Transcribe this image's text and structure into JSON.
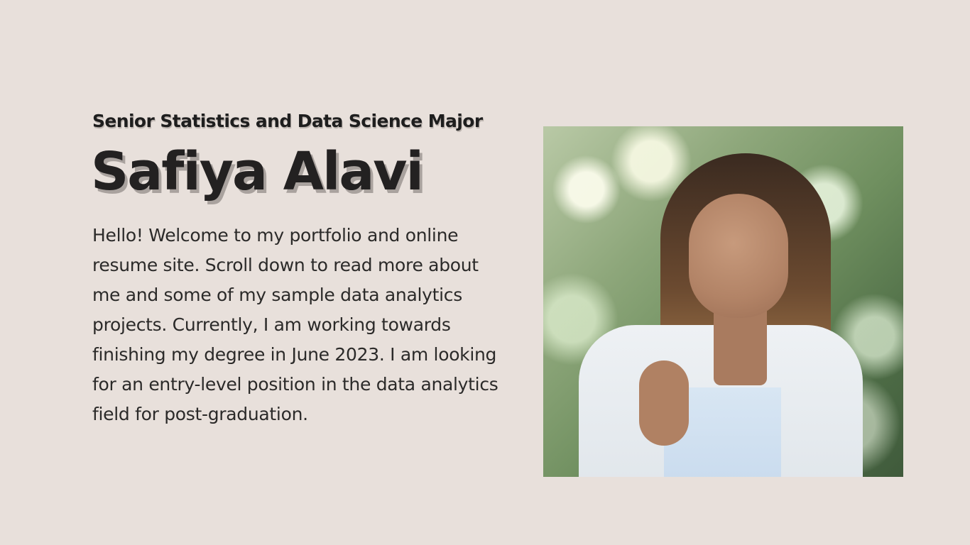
{
  "header": {
    "subtitle": "Senior Statistics and Data Science Major",
    "name": "Safiya Alavi"
  },
  "bio": {
    "text": "Hello! Welcome to my portfolio and online resume site. Scroll down to read more about me and some of my sample data analytics projects. Currently, I am working towards finishing my degree in June 2023. I am looking for an entry-level position in the data analytics field for post-graduation."
  },
  "colors": {
    "background": "#e8e0db",
    "text": "#232121",
    "shadow": "#a9a29e"
  }
}
